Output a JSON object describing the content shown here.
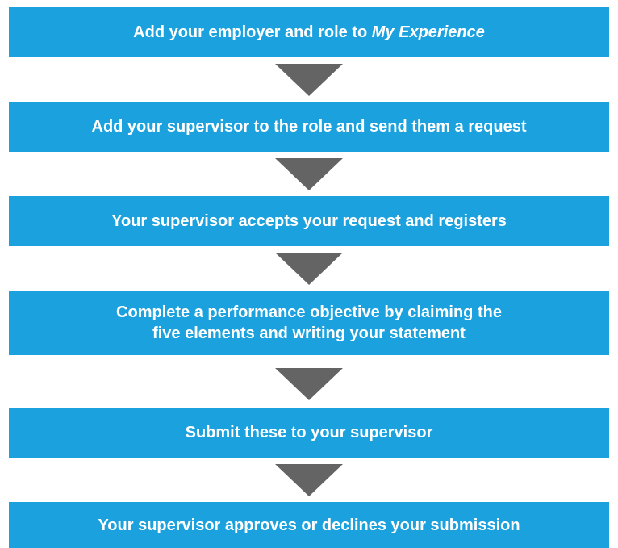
{
  "flow": {
    "steps": [
      {
        "text": "Add your employer and role to ",
        "emphasis": "My Experience"
      },
      {
        "text": "Add your supervisor to the role and send them a request"
      },
      {
        "text": "Your supervisor accepts your request and registers"
      },
      {
        "lines": [
          "Complete a performance objective by claiming the",
          "five elements and writing your statement"
        ]
      },
      {
        "text": "Submit these to your supervisor"
      },
      {
        "text": "Your supervisor approves or declines your submission"
      }
    ],
    "colors": {
      "box": "#1ba1dd",
      "arrow": "#646464",
      "text": "#ffffff"
    }
  }
}
